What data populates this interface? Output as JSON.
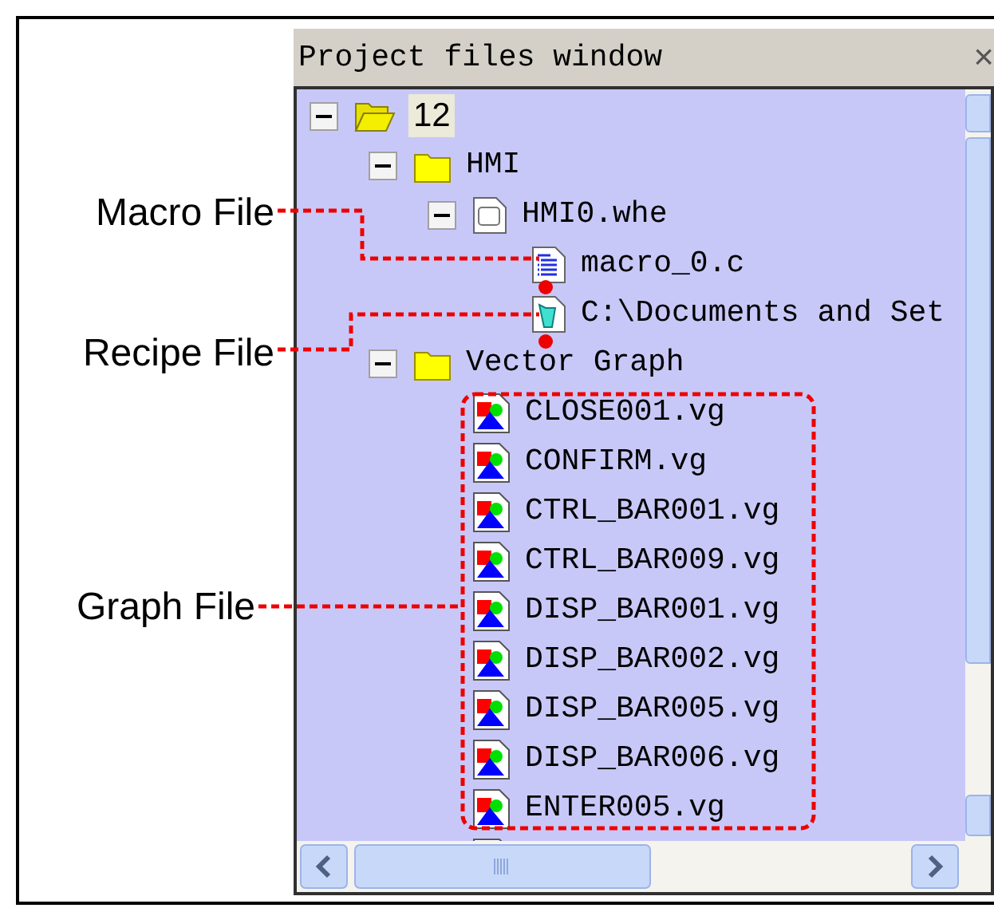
{
  "annotations": [
    {
      "label": "Macro File"
    },
    {
      "label": "Recipe File"
    },
    {
      "label": "Graph File"
    }
  ],
  "window": {
    "title": "Project files window",
    "close": "×"
  },
  "tree": [
    {
      "kind": "project",
      "label": "12",
      "selected": true,
      "expanded": true,
      "children": [
        {
          "kind": "folder",
          "label": "HMI",
          "selected": false,
          "expanded": true,
          "children": [
            {
              "kind": "screen",
              "label": "HMI0.whe",
              "selected": false,
              "expanded": true,
              "children": [
                {
                  "kind": "macro",
                  "label": "macro_0.c",
                  "selected": false
                },
                {
                  "kind": "recipe",
                  "label": "C:\\Documents and Set",
                  "selected": false
                }
              ]
            }
          ]
        },
        {
          "kind": "folder",
          "label": "Vector Graph",
          "selected": false,
          "expanded": true,
          "children": [
            {
              "kind": "graph",
              "label": "CLOSE001.vg",
              "selected": false
            },
            {
              "kind": "graph",
              "label": "CONFIRM.vg",
              "selected": false
            },
            {
              "kind": "graph",
              "label": "CTRL_BAR001.vg",
              "selected": false
            },
            {
              "kind": "graph",
              "label": "CTRL_BAR009.vg",
              "selected": false
            },
            {
              "kind": "graph",
              "label": "DISP_BAR001.vg",
              "selected": false
            },
            {
              "kind": "graph",
              "label": "DISP_BAR002.vg",
              "selected": false
            },
            {
              "kind": "graph",
              "label": "DISP_BAR005.vg",
              "selected": false
            },
            {
              "kind": "graph",
              "label": "DISP_BAR006.vg",
              "selected": false
            },
            {
              "kind": "graph",
              "label": "ENTER005.vg",
              "selected": false
            },
            {
              "kind": "graph",
              "selected": false
            }
          ]
        }
      ]
    }
  ]
}
